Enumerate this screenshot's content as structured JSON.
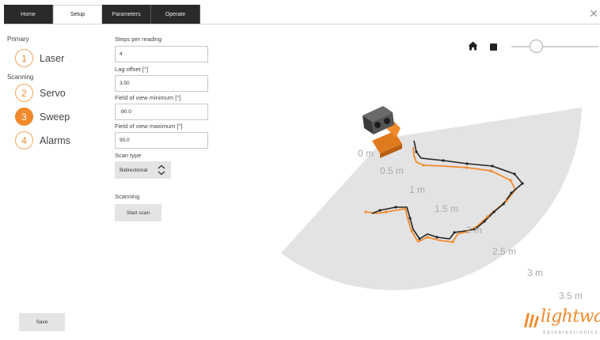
{
  "tabs": [
    {
      "label": "Home",
      "active": false
    },
    {
      "label": "Setup",
      "active": true
    },
    {
      "label": "Parameters",
      "active": false
    },
    {
      "label": "Operate",
      "active": false
    }
  ],
  "sections": {
    "primary": "Primary",
    "scanning": "Scanning"
  },
  "steps": [
    {
      "num": "1",
      "label": "Laser",
      "active": false
    },
    {
      "num": "2",
      "label": "Servo",
      "active": false
    },
    {
      "num": "3",
      "label": "Sweep",
      "active": true
    },
    {
      "num": "4",
      "label": "Alarms",
      "active": false
    }
  ],
  "fields": {
    "steps_per_reading": {
      "label": "Steps per reading",
      "value": "4"
    },
    "lag_offset": {
      "label": "Lag offset [°]",
      "value": "3.50"
    },
    "fov_min": {
      "label": "Field of view minimum [°]",
      "value": "-90.0"
    },
    "fov_max": {
      "label": "Field of view maximum [°]",
      "value": "90.0"
    }
  },
  "scan_type": {
    "label": "Scan type",
    "value": "Bidirectional"
  },
  "scanning": {
    "label": "Scanning",
    "button": "Start scan"
  },
  "save_button": "Save",
  "distances": [
    "0 m",
    "0.5 m",
    "1 m",
    "1.5 m",
    "2 m",
    "2.5 m",
    "3 m",
    "3.5 m"
  ],
  "logo": {
    "word": "lightware",
    "sub": "optoelectronics"
  },
  "colors": {
    "accent": "#f08a2c",
    "tab_dark": "#2a2a2a",
    "scan_area": "#e3e3e3"
  }
}
